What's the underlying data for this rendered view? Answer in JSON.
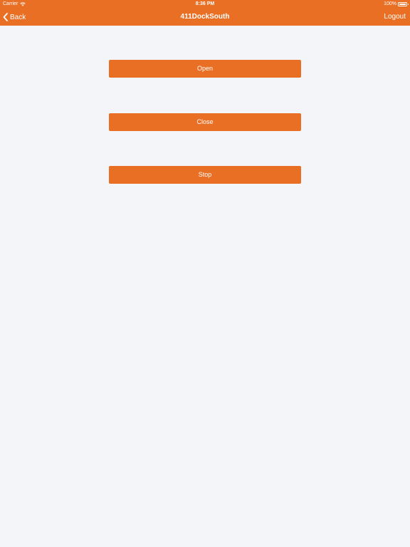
{
  "status": {
    "carrier": "Carrier",
    "time": "8:36 PM",
    "battery": "100%"
  },
  "nav": {
    "back_label": "Back",
    "title": "411DockSouth",
    "logout_label": "Logout"
  },
  "actions": {
    "open_label": "Open",
    "close_label": "Close",
    "stop_label": "Stop"
  },
  "colors": {
    "accent": "#e96f24",
    "background": "#f3f5f9",
    "text_on_accent": "#ffffff"
  },
  "icons": {
    "back": "chevron-left-icon",
    "wifi": "wifi-icon",
    "battery": "battery-icon"
  }
}
